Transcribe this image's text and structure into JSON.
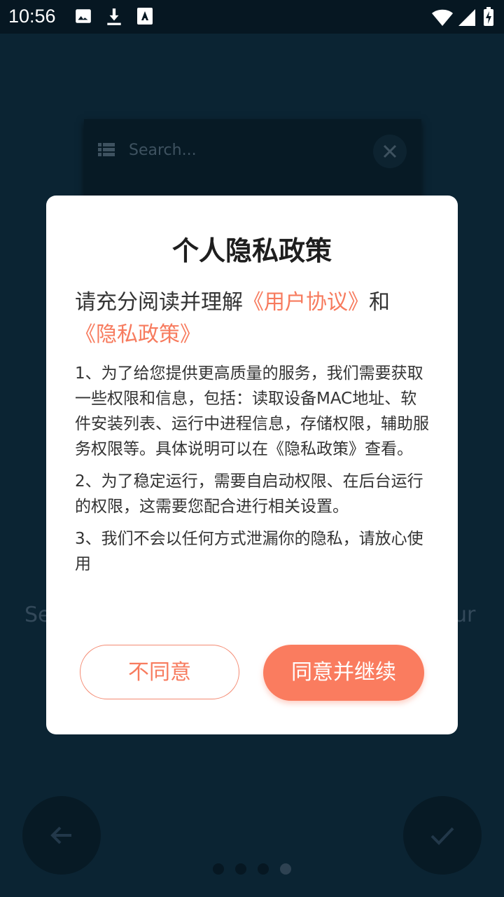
{
  "status_bar": {
    "time": "10:56",
    "icons": [
      "image-icon",
      "download-icon",
      "text-icon",
      "wifi-icon",
      "signal-icon",
      "battery-charging-icon"
    ]
  },
  "background": {
    "search_placeholder": "Search...",
    "left_text": "Se",
    "right_text": "ur",
    "page_dots": 4
  },
  "dialog": {
    "title": "个人隐私政策",
    "subtitle_prefix": "请充分阅读并理解",
    "user_agreement_link": "《用户协议》",
    "subtitle_and": "和",
    "privacy_policy_link": "《隐私政策》",
    "paragraphs": [
      "1、为了给您提供更高质量的服务，我们需要获取一些权限和信息，包括：读取设备MAC地址、软件安装列表、运行中进程信息，存储权限，辅助服务权限等。具体说明可以在《隐私政策》查看。",
      "2、为了稳定运行，需要自启动权限、在后台运行的权限，这需要您配合进行相关设置。",
      "3、我们不会以任何方式泄漏你的隐私，请放心使用"
    ],
    "disagree_label": "不同意",
    "agree_label": "同意并继续"
  },
  "colors": {
    "accent": "#fa7c5f",
    "link": "#f77b5e",
    "background": "#0b2433"
  }
}
